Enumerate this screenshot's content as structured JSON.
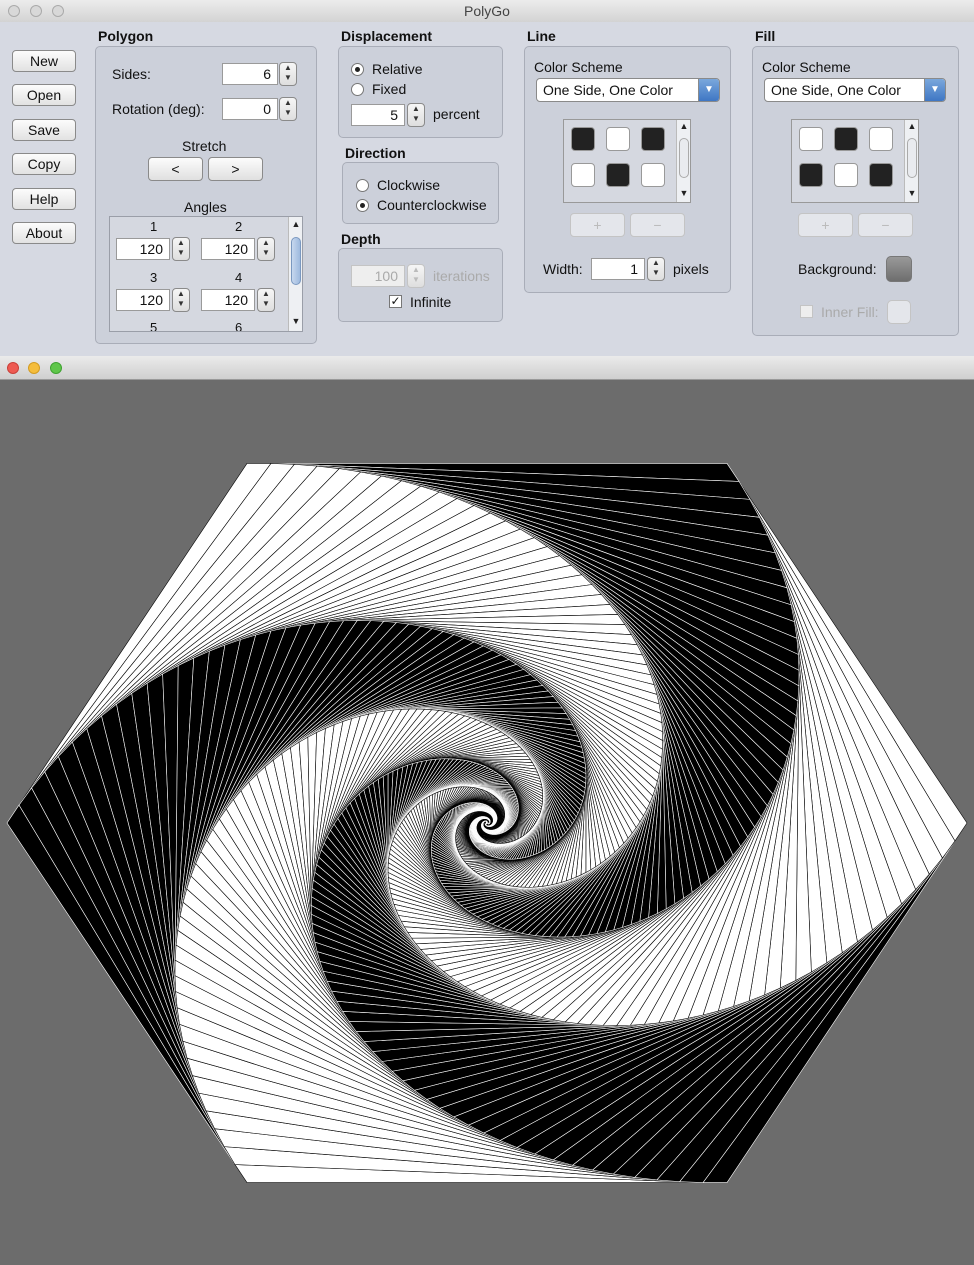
{
  "app": {
    "title": "PolyGo"
  },
  "buttons": [
    "New",
    "Open",
    "Save",
    "Copy",
    "Help",
    "About"
  ],
  "polygon": {
    "title": "Polygon",
    "sides_label": "Sides:",
    "sides_value": "6",
    "rotation_label": "Rotation (deg):",
    "rotation_value": "0",
    "stretch_label": "Stretch",
    "stretch_left": "<",
    "stretch_right": ">",
    "angles_label": "Angles",
    "angles": [
      {
        "index": "1",
        "value": "120"
      },
      {
        "index": "2",
        "value": "120"
      },
      {
        "index": "3",
        "value": "120"
      },
      {
        "index": "4",
        "value": "120"
      },
      {
        "index": "5",
        "value": ""
      },
      {
        "index": "6",
        "value": ""
      }
    ]
  },
  "displacement": {
    "title": "Displacement",
    "relative_label": "Relative",
    "fixed_label": "Fixed",
    "selected": "Relative",
    "value": "5",
    "unit": "percent"
  },
  "direction": {
    "title": "Direction",
    "clockwise_label": "Clockwise",
    "counterclockwise_label": "Counterclockwise",
    "selected": "Counterclockwise"
  },
  "depth": {
    "title": "Depth",
    "iterations_value": "100",
    "iterations_label": "iterations",
    "infinite_label": "Infinite",
    "infinite_checked": true
  },
  "line": {
    "title": "Line",
    "scheme_label": "Color Scheme",
    "scheme_value": "One Side, One Color",
    "swatches": [
      "dark",
      "light",
      "dark",
      "light",
      "dark",
      "light"
    ],
    "add_label": "+",
    "remove_label": "−",
    "width_label": "Width:",
    "width_value": "1",
    "width_unit": "pixels"
  },
  "fill": {
    "title": "Fill",
    "scheme_label": "Color Scheme",
    "scheme_value": "One Side, One Color",
    "swatches": [
      "light",
      "dark",
      "light",
      "dark",
      "light",
      "dark"
    ],
    "add_label": "+",
    "remove_label": "−",
    "background_label": "Background:",
    "inner_fill_label": "Inner Fill:"
  },
  "colors": {
    "canvas_background": "#6c6c6c",
    "spiral_light": "#ffffff",
    "spiral_dark": "#000000"
  }
}
